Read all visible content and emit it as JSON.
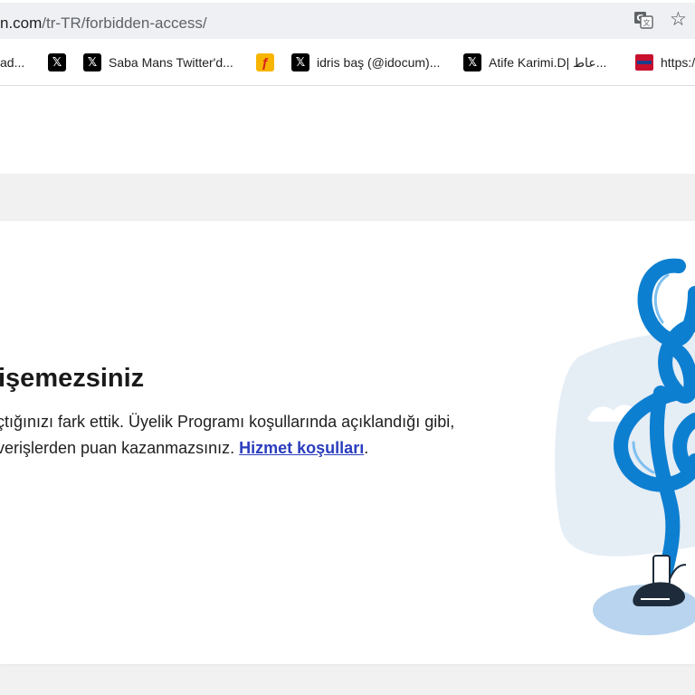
{
  "browser": {
    "url_host": "n.com",
    "url_path": "/tr-TR/forbidden-access/",
    "bookmarks": [
      {
        "label": "ad...",
        "icon": "none"
      },
      {
        "label": "",
        "icon": "x-logo-icon"
      },
      {
        "label": "Saba Mans Twitter'd...",
        "icon": "x-logo-icon"
      },
      {
        "label": "",
        "icon": "orange-site-icon"
      },
      {
        "label": "idris baş (@idocum)...",
        "icon": "x-logo-icon"
      },
      {
        "label": "Atife Karimi.D| عاط...",
        "icon": "x-logo-icon"
      },
      {
        "label": "https:/",
        "icon": "news-site-icon"
      }
    ]
  },
  "page": {
    "title": "işemezsiniz",
    "description_line1": "çtığınızı fark ettik. Üyelik Programı koşullarında açıklandığı gibi,",
    "description_line2": "verişlerden puan kazanmazsınız.",
    "terms_link": "Hizmet koşulları",
    "terms_suffix": "."
  },
  "colors": {
    "link": "#2a3dbd",
    "illustration_blue": "#0d7fd1",
    "illustration_light": "#e5edf5"
  }
}
